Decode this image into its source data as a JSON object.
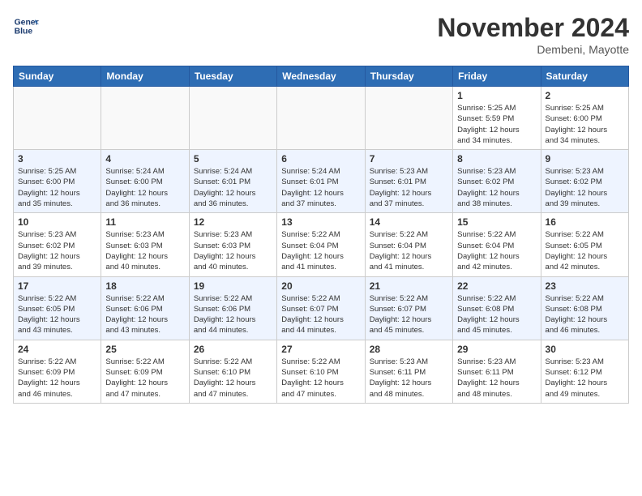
{
  "header": {
    "logo_line1": "General",
    "logo_line2": "Blue",
    "month": "November 2024",
    "location": "Dembeni, Mayotte"
  },
  "weekdays": [
    "Sunday",
    "Monday",
    "Tuesday",
    "Wednesday",
    "Thursday",
    "Friday",
    "Saturday"
  ],
  "weeks": [
    [
      {
        "day": "",
        "info": ""
      },
      {
        "day": "",
        "info": ""
      },
      {
        "day": "",
        "info": ""
      },
      {
        "day": "",
        "info": ""
      },
      {
        "day": "",
        "info": ""
      },
      {
        "day": "1",
        "info": "Sunrise: 5:25 AM\nSunset: 5:59 PM\nDaylight: 12 hours\nand 34 minutes."
      },
      {
        "day": "2",
        "info": "Sunrise: 5:25 AM\nSunset: 6:00 PM\nDaylight: 12 hours\nand 34 minutes."
      }
    ],
    [
      {
        "day": "3",
        "info": "Sunrise: 5:25 AM\nSunset: 6:00 PM\nDaylight: 12 hours\nand 35 minutes."
      },
      {
        "day": "4",
        "info": "Sunrise: 5:24 AM\nSunset: 6:00 PM\nDaylight: 12 hours\nand 36 minutes."
      },
      {
        "day": "5",
        "info": "Sunrise: 5:24 AM\nSunset: 6:01 PM\nDaylight: 12 hours\nand 36 minutes."
      },
      {
        "day": "6",
        "info": "Sunrise: 5:24 AM\nSunset: 6:01 PM\nDaylight: 12 hours\nand 37 minutes."
      },
      {
        "day": "7",
        "info": "Sunrise: 5:23 AM\nSunset: 6:01 PM\nDaylight: 12 hours\nand 37 minutes."
      },
      {
        "day": "8",
        "info": "Sunrise: 5:23 AM\nSunset: 6:02 PM\nDaylight: 12 hours\nand 38 minutes."
      },
      {
        "day": "9",
        "info": "Sunrise: 5:23 AM\nSunset: 6:02 PM\nDaylight: 12 hours\nand 39 minutes."
      }
    ],
    [
      {
        "day": "10",
        "info": "Sunrise: 5:23 AM\nSunset: 6:02 PM\nDaylight: 12 hours\nand 39 minutes."
      },
      {
        "day": "11",
        "info": "Sunrise: 5:23 AM\nSunset: 6:03 PM\nDaylight: 12 hours\nand 40 minutes."
      },
      {
        "day": "12",
        "info": "Sunrise: 5:23 AM\nSunset: 6:03 PM\nDaylight: 12 hours\nand 40 minutes."
      },
      {
        "day": "13",
        "info": "Sunrise: 5:22 AM\nSunset: 6:04 PM\nDaylight: 12 hours\nand 41 minutes."
      },
      {
        "day": "14",
        "info": "Sunrise: 5:22 AM\nSunset: 6:04 PM\nDaylight: 12 hours\nand 41 minutes."
      },
      {
        "day": "15",
        "info": "Sunrise: 5:22 AM\nSunset: 6:04 PM\nDaylight: 12 hours\nand 42 minutes."
      },
      {
        "day": "16",
        "info": "Sunrise: 5:22 AM\nSunset: 6:05 PM\nDaylight: 12 hours\nand 42 minutes."
      }
    ],
    [
      {
        "day": "17",
        "info": "Sunrise: 5:22 AM\nSunset: 6:05 PM\nDaylight: 12 hours\nand 43 minutes."
      },
      {
        "day": "18",
        "info": "Sunrise: 5:22 AM\nSunset: 6:06 PM\nDaylight: 12 hours\nand 43 minutes."
      },
      {
        "day": "19",
        "info": "Sunrise: 5:22 AM\nSunset: 6:06 PM\nDaylight: 12 hours\nand 44 minutes."
      },
      {
        "day": "20",
        "info": "Sunrise: 5:22 AM\nSunset: 6:07 PM\nDaylight: 12 hours\nand 44 minutes."
      },
      {
        "day": "21",
        "info": "Sunrise: 5:22 AM\nSunset: 6:07 PM\nDaylight: 12 hours\nand 45 minutes."
      },
      {
        "day": "22",
        "info": "Sunrise: 5:22 AM\nSunset: 6:08 PM\nDaylight: 12 hours\nand 45 minutes."
      },
      {
        "day": "23",
        "info": "Sunrise: 5:22 AM\nSunset: 6:08 PM\nDaylight: 12 hours\nand 46 minutes."
      }
    ],
    [
      {
        "day": "24",
        "info": "Sunrise: 5:22 AM\nSunset: 6:09 PM\nDaylight: 12 hours\nand 46 minutes."
      },
      {
        "day": "25",
        "info": "Sunrise: 5:22 AM\nSunset: 6:09 PM\nDaylight: 12 hours\nand 47 minutes."
      },
      {
        "day": "26",
        "info": "Sunrise: 5:22 AM\nSunset: 6:10 PM\nDaylight: 12 hours\nand 47 minutes."
      },
      {
        "day": "27",
        "info": "Sunrise: 5:22 AM\nSunset: 6:10 PM\nDaylight: 12 hours\nand 47 minutes."
      },
      {
        "day": "28",
        "info": "Sunrise: 5:23 AM\nSunset: 6:11 PM\nDaylight: 12 hours\nand 48 minutes."
      },
      {
        "day": "29",
        "info": "Sunrise: 5:23 AM\nSunset: 6:11 PM\nDaylight: 12 hours\nand 48 minutes."
      },
      {
        "day": "30",
        "info": "Sunrise: 5:23 AM\nSunset: 6:12 PM\nDaylight: 12 hours\nand 49 minutes."
      }
    ]
  ]
}
